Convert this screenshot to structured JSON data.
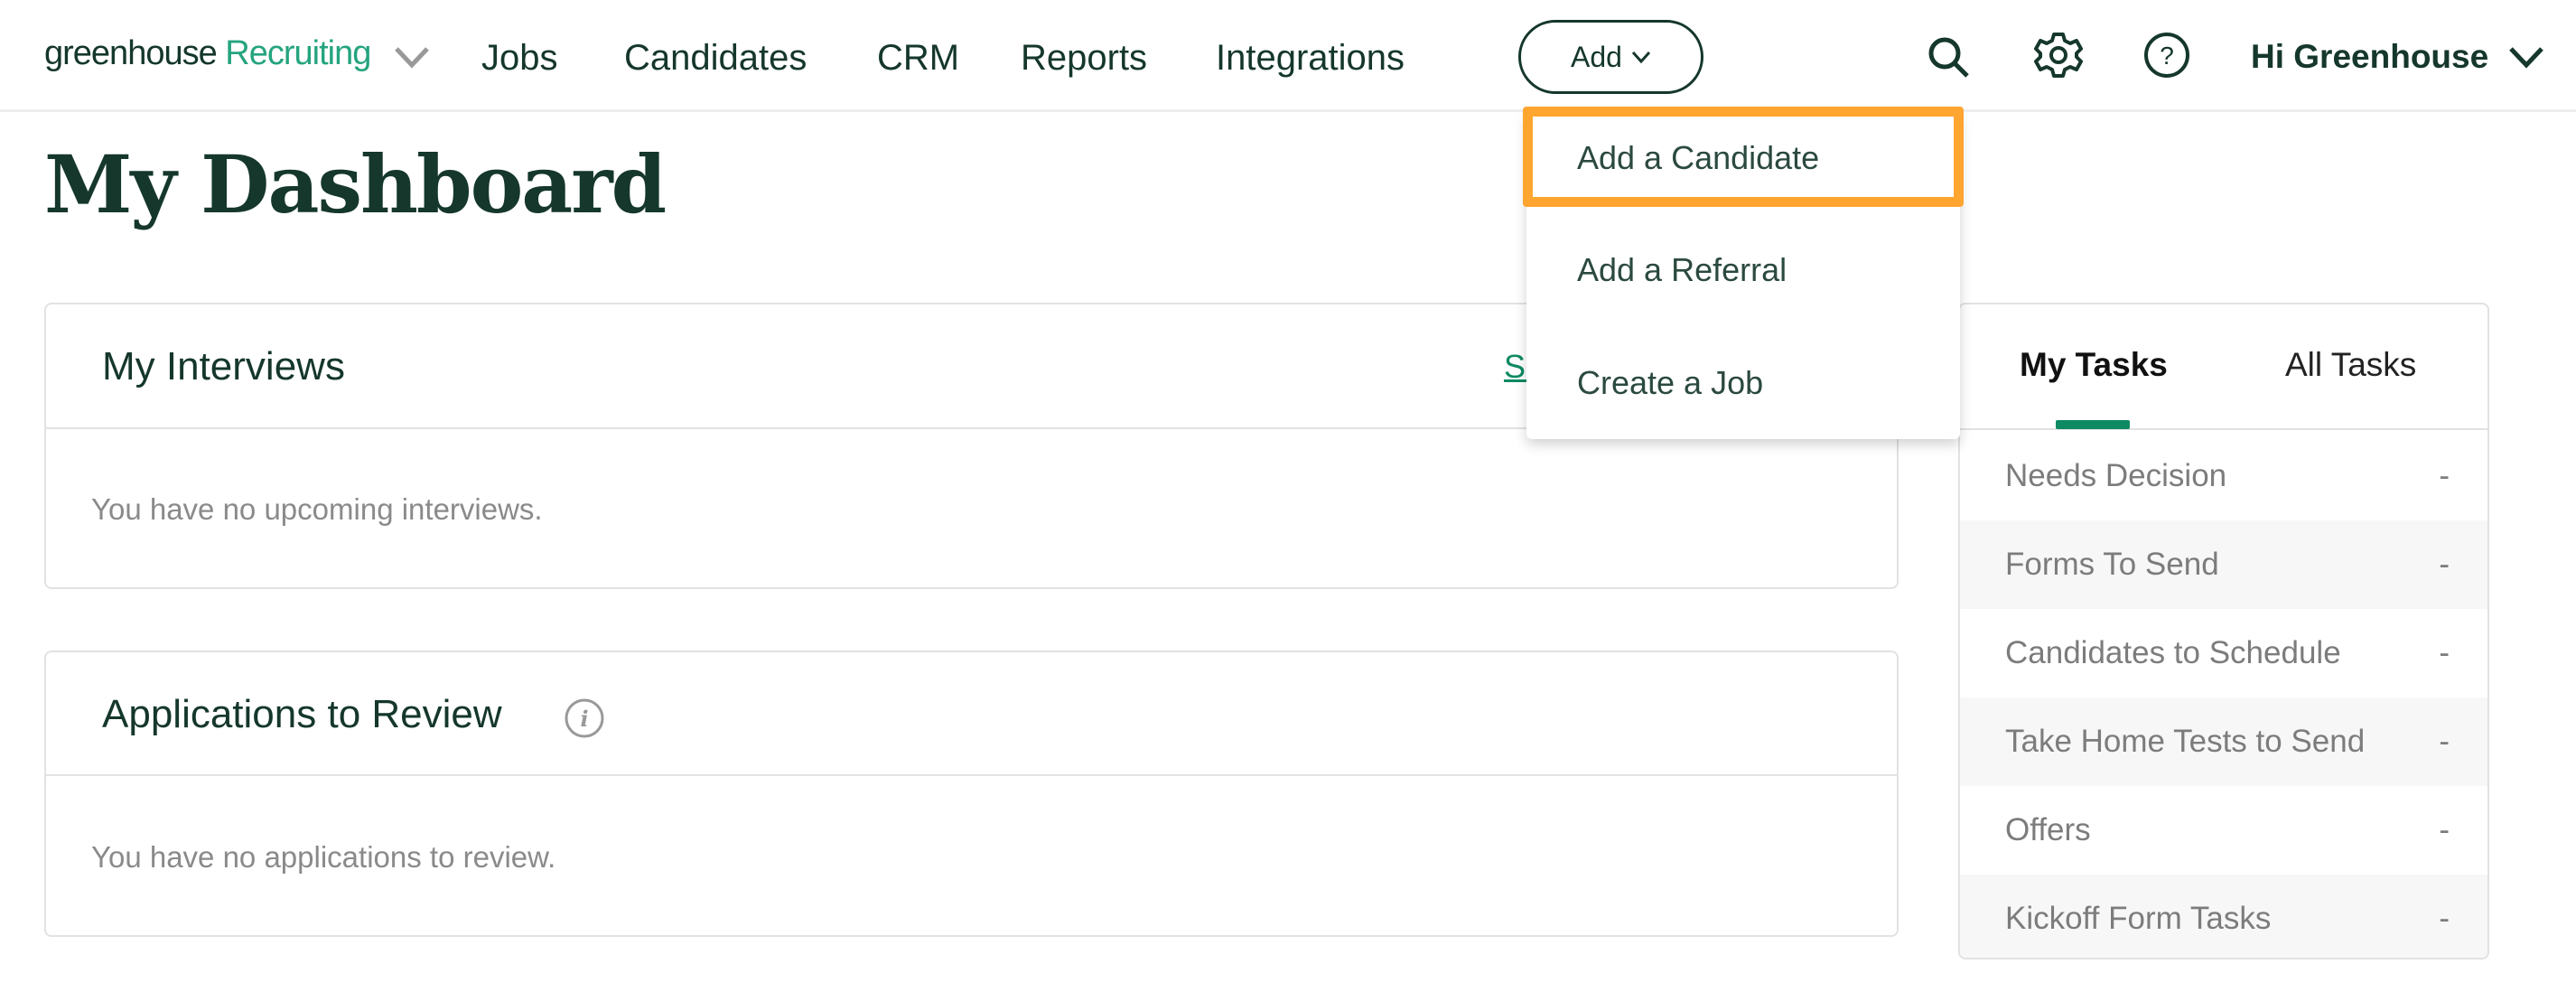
{
  "nav": {
    "logo_brand": "greenhouse",
    "logo_product": "Recruiting",
    "links": [
      "Jobs",
      "Candidates",
      "CRM",
      "Reports",
      "Integrations"
    ],
    "add_label": "Add",
    "user_label": "Hi Greenhouse",
    "icons": [
      "search-icon",
      "gear-icon",
      "help-icon",
      "chevron-down-icon"
    ]
  },
  "page": {
    "title": "My Dashboard"
  },
  "interviews": {
    "title": "My Interviews",
    "link": "See all",
    "empty": "You have no upcoming interviews."
  },
  "applications": {
    "title": "Applications to Review",
    "empty": "You have no applications to review."
  },
  "tasks": {
    "tabs": [
      "My Tasks",
      "All Tasks"
    ],
    "active_tab": "My Tasks",
    "rows": [
      {
        "label": "Needs Decision",
        "value": "-"
      },
      {
        "label": "Forms To Send",
        "value": "-"
      },
      {
        "label": "Candidates to Schedule",
        "value": "-"
      },
      {
        "label": "Take Home Tests to Send",
        "value": "-"
      },
      {
        "label": "Offers",
        "value": "-"
      },
      {
        "label": "Kickoff Form Tasks",
        "value": "-"
      }
    ]
  },
  "add_menu": {
    "items": [
      "Add a Candidate",
      "Add a Referral",
      "Create a Job"
    ],
    "highlighted": "Add a Candidate"
  },
  "colors": {
    "primary": "#15372c",
    "brand_green": "#24a47f",
    "tab_underline": "#0e8a63",
    "highlight": "#ffa530"
  }
}
